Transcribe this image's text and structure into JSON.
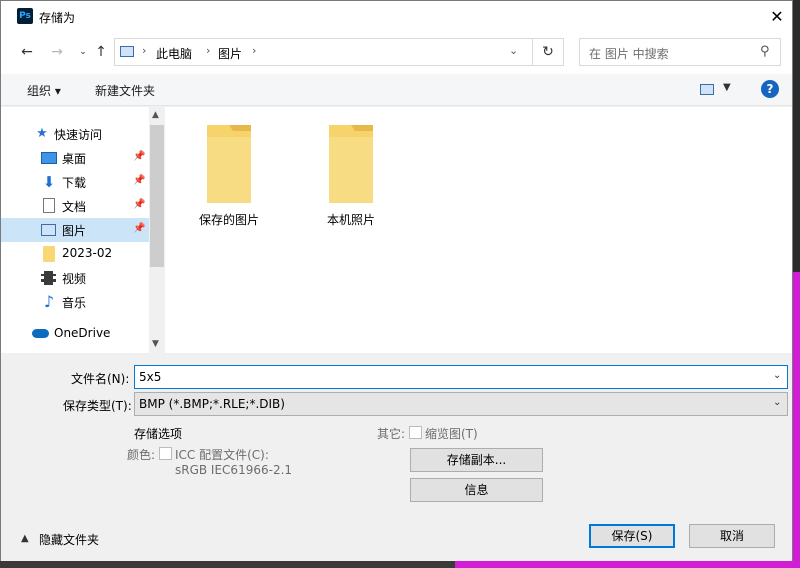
{
  "dialog": {
    "title": "存储为",
    "app_icon": "Ps"
  },
  "address": {
    "segments": [
      "此电脑",
      "图片"
    ],
    "search_placeholder": "在 图片 中搜索"
  },
  "toolbar": {
    "organize": "组织 ▾",
    "new_folder": "新建文件夹"
  },
  "nav": {
    "items": [
      {
        "label": "快速访问",
        "icon": "star-icon"
      },
      {
        "label": "桌面",
        "icon": "desktop-icon",
        "pinned": true
      },
      {
        "label": "下载",
        "icon": "download-icon",
        "pinned": true
      },
      {
        "label": "文档",
        "icon": "document-icon",
        "pinned": true
      },
      {
        "label": "图片",
        "icon": "pictures-icon",
        "pinned": true,
        "selected": true
      },
      {
        "label": "2023-02",
        "icon": "folder-icon"
      },
      {
        "label": "视频",
        "icon": "video-icon"
      },
      {
        "label": "音乐",
        "icon": "music-icon"
      },
      {
        "label": "OneDrive",
        "icon": "cloud-icon"
      }
    ]
  },
  "files": [
    {
      "name": "保存的图片"
    },
    {
      "name": "本机照片"
    }
  ],
  "form": {
    "filename_label": "文件名(N):",
    "filename_value": "5x5",
    "filetype_label": "保存类型(T):",
    "filetype_value": "BMP (*.BMP;*.RLE;*.DIB)",
    "save_options_heading": "存储选项",
    "color_label": "颜色:",
    "icc_label": "ICC 配置文件(C):",
    "icc_profile": "sRGB IEC61966-2.1",
    "other_label": "其它:",
    "thumbnail_label": "缩览图(T)",
    "save_copy_button": "存储副本...",
    "info_button": "信息",
    "hide_folders": "隐藏文件夹",
    "save_button": "保存(S)",
    "cancel_button": "取消"
  },
  "colors": {
    "accent": "#0078d7",
    "selected_bg": "#cce4f7",
    "folder": "#f8d775"
  }
}
